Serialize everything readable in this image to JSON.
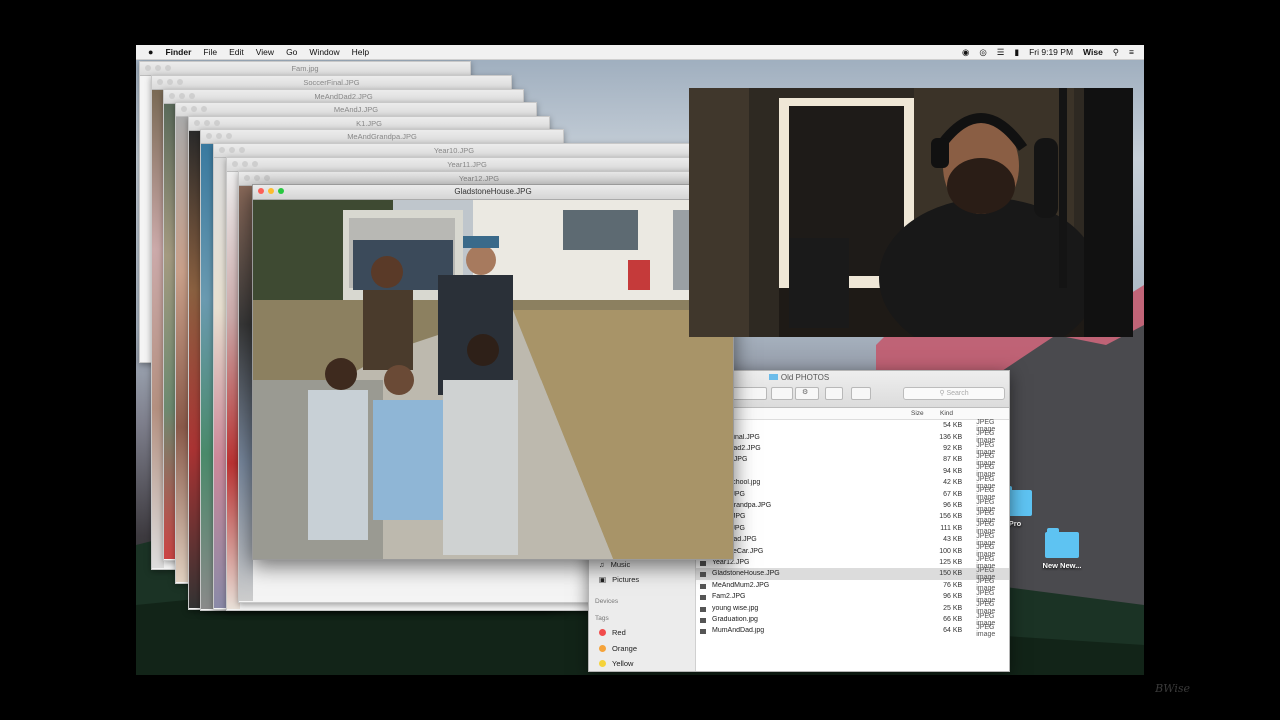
{
  "menubar": {
    "apple": "",
    "app": "Finder",
    "items": [
      "File",
      "Edit",
      "View",
      "Go",
      "Window",
      "Help"
    ],
    "clock": "Fri 9:19 PM",
    "user": "Wise"
  },
  "preview_windows": [
    {
      "title": "Fam.jpg"
    },
    {
      "title": "SoccerFinal.JPG"
    },
    {
      "title": "MeAndDad2.JPG"
    },
    {
      "title": "MeAndJ.JPG"
    },
    {
      "title": "K1.JPG"
    },
    {
      "title": "MeAndGrandpa.JPG"
    },
    {
      "title": "Year10.JPG"
    },
    {
      "title": "Year11.JPG"
    },
    {
      "title": "Year12.JPG"
    },
    {
      "title": "GladstoneHouse.JPG"
    }
  ],
  "finder": {
    "title": "Old PHOTOS",
    "search_placeholder": "Search",
    "columns": {
      "size": "Size",
      "kind": "Kind"
    },
    "sidebar": {
      "music": "Music",
      "pictures": "Pictures",
      "devices_header": "Devices",
      "tags_header": "Tags",
      "tags": [
        {
          "label": "Red",
          "color": "#f14b4b"
        },
        {
          "label": "Orange",
          "color": "#f5a33a"
        },
        {
          "label": "Yellow",
          "color": "#f5d33a"
        }
      ]
    },
    "files": [
      {
        "name": "m.jpg",
        "size": "54 KB",
        "kind": "JPEG image"
      },
      {
        "name": "occerFinal.JPG",
        "size": "136 KB",
        "kind": "JPEG image"
      },
      {
        "name": "eAndDad2.JPG",
        "size": "92 KB",
        "kind": "JPEG image"
      },
      {
        "name": "eAndJ.JPG",
        "size": "87 KB",
        "kind": "JPEG image"
      },
      {
        "name": ".JPG",
        "size": "94 KB",
        "kind": "JPEG image"
      },
      {
        "name": "geriaSchool.jpg",
        "size": "42 KB",
        "kind": "JPEG image"
      },
      {
        "name": "stDay.JPG",
        "size": "67 KB",
        "kind": "JPEG image"
      },
      {
        "name": "eAndGrandpa.JPG",
        "size": "96 KB",
        "kind": "JPEG image"
      },
      {
        "name": "ear10.JPG",
        "size": "156 KB",
        "kind": "JPEG image"
      },
      {
        "name": "ear11.JPG",
        "size": "111 KB",
        "kind": "JPEG image"
      },
      {
        "name": "eAndDad.JPG",
        "size": "43 KB",
        "kind": "JPEG image"
      },
      {
        "name": "adstoneCar.JPG",
        "size": "100 KB",
        "kind": "JPEG image"
      },
      {
        "name": "Year12.JPG",
        "size": "125 KB",
        "kind": "JPEG image"
      },
      {
        "name": "GladstoneHouse.JPG",
        "size": "150 KB",
        "kind": "JPEG image",
        "selected": true
      },
      {
        "name": "MeAndMum2.JPG",
        "size": "76 KB",
        "kind": "JPEG image"
      },
      {
        "name": "Fam2.JPG",
        "size": "96 KB",
        "kind": "JPEG image"
      },
      {
        "name": "young wise.jpg",
        "size": "25 KB",
        "kind": "JPEG image"
      },
      {
        "name": "Graduation.jpg",
        "size": "66 KB",
        "kind": "JPEG image"
      },
      {
        "name": "MumAndDad.jpg",
        "size": "64 KB",
        "kind": "JPEG image"
      }
    ]
  },
  "desktop": {
    "icons": [
      {
        "label": "Pro"
      },
      {
        "label": "New New..."
      }
    ]
  },
  "watermark": "BWise"
}
